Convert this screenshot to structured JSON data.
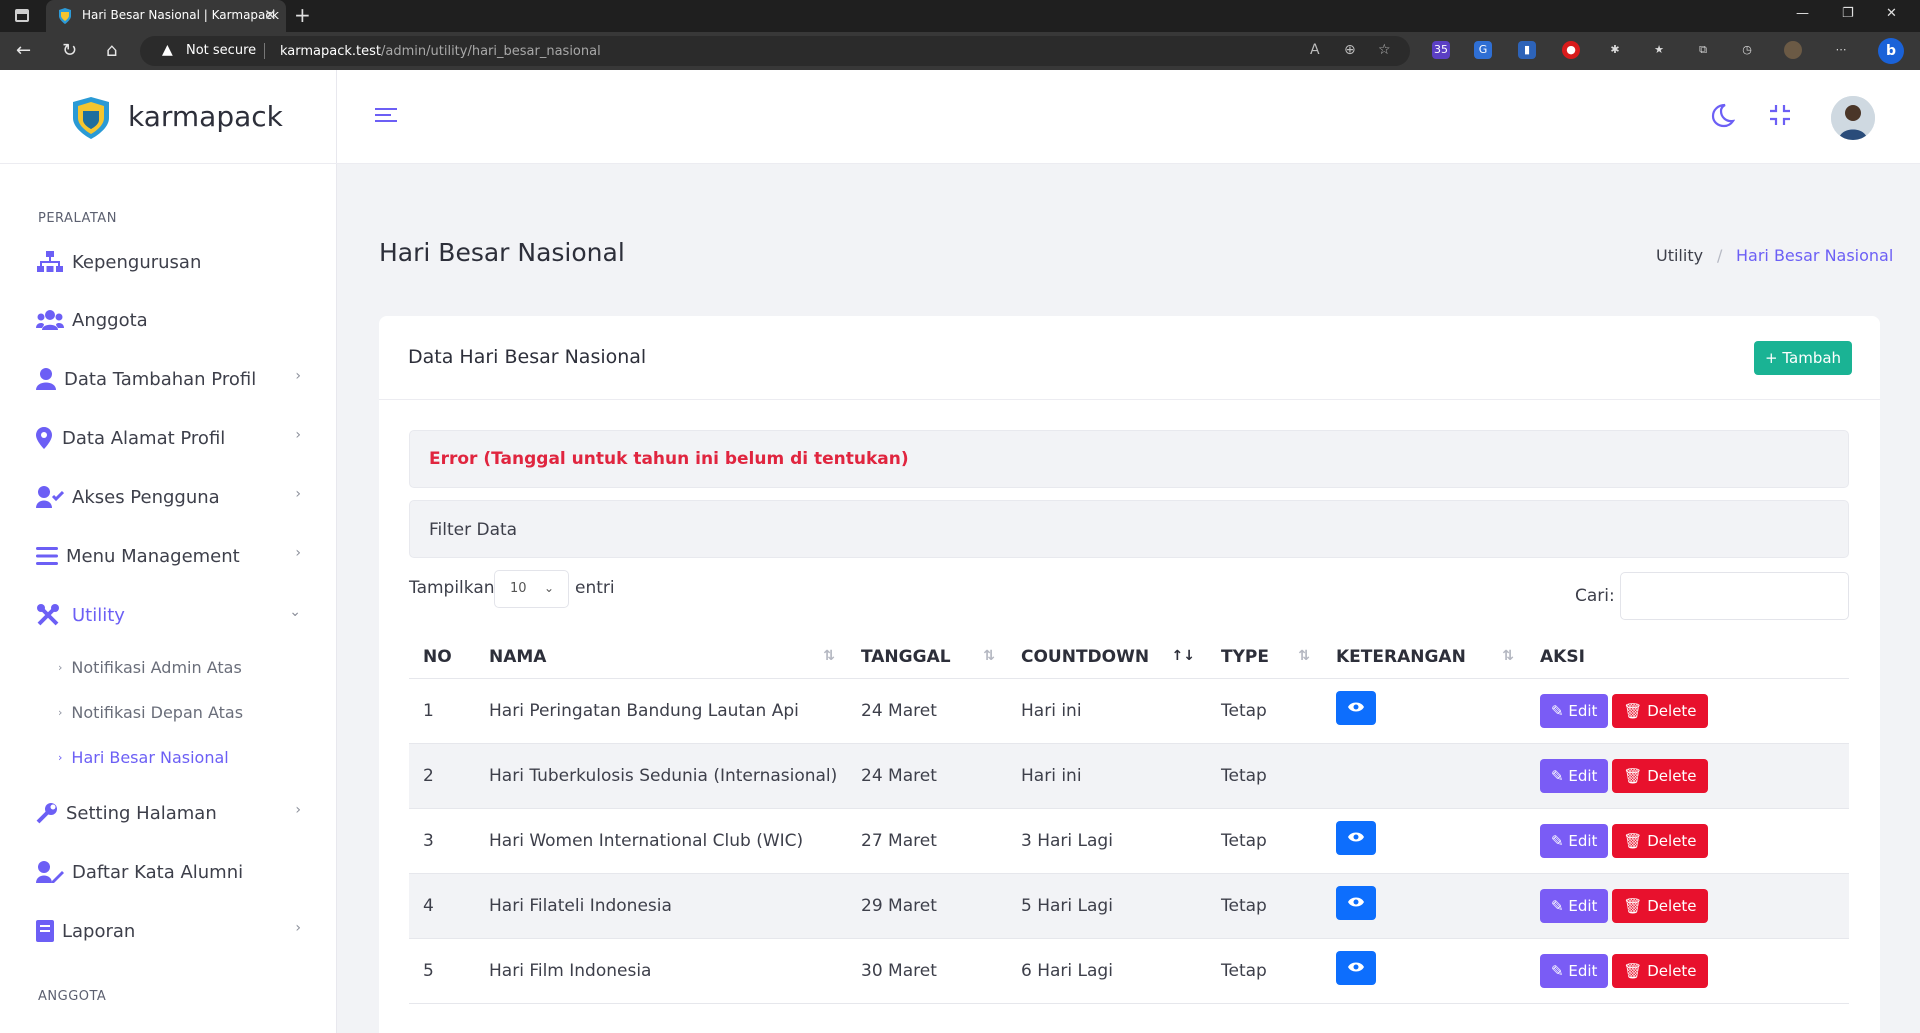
{
  "browser": {
    "tab_title": "Hari Besar Nasional | Karmapack",
    "security_label": "Not secure",
    "url_host": "karmapack.test",
    "url_path": "/admin/utility/hari_besar_nasional",
    "extension_badge": "35"
  },
  "sidebar": {
    "logo_text": "karmapack",
    "section_peralatan": "PERALATAN",
    "section_anggota": "ANGGOTA",
    "items": [
      {
        "label": "Kepengurusan",
        "icon": "sitemap-icon"
      },
      {
        "label": "Anggota",
        "icon": "users-icon"
      },
      {
        "label": "Data Tambahan Profil",
        "icon": "user-icon"
      },
      {
        "label": "Data Alamat Profil",
        "icon": "map-pin-icon"
      },
      {
        "label": "Akses Pengguna",
        "icon": "user-check-icon"
      },
      {
        "label": "Menu Management",
        "icon": "bars-icon"
      },
      {
        "label": "Utility",
        "icon": "tools-icon"
      },
      {
        "label": "Setting Halaman",
        "icon": "wrench-icon"
      },
      {
        "label": "Daftar Kata Alumni",
        "icon": "user-edit-icon"
      },
      {
        "label": "Laporan",
        "icon": "book-icon"
      }
    ],
    "utility_sub": [
      {
        "label": "Notifikasi Admin Atas"
      },
      {
        "label": "Notifikasi Depan Atas"
      },
      {
        "label": "Hari Besar Nasional"
      }
    ]
  },
  "page": {
    "title": "Hari Besar Nasional",
    "breadcrumb": [
      "Utility",
      "Hari Besar Nasional"
    ],
    "breadcrumb_sep": "/"
  },
  "card": {
    "title": "Data Hari Besar Nasional",
    "add_button": "Tambah",
    "error_text": "Error (Tanggal untuk tahun ini belum di tentukan)",
    "filter_text": "Filter Data",
    "show_label": "Tampilkan",
    "show_value": "10",
    "entries_label": "entri",
    "search_label": "Cari:"
  },
  "table": {
    "headers": [
      "NO",
      "NAMA",
      "TANGGAL",
      "COUNTDOWN",
      "TYPE",
      "KETERANGAN",
      "AKSI"
    ],
    "rows": [
      {
        "no": "1",
        "nama": "Hari Peringatan Bandung Lautan Api",
        "tanggal": "24 Maret",
        "countdown": "Hari ini",
        "type": "Tetap",
        "has_info": true
      },
      {
        "no": "2",
        "nama": "Hari Tuberkulosis Sedunia (Internasional)",
        "tanggal": "24 Maret",
        "countdown": "Hari ini",
        "type": "Tetap",
        "has_info": false
      },
      {
        "no": "3",
        "nama": "Hari Women International Club (WIC)",
        "tanggal": "27 Maret",
        "countdown": "3 Hari Lagi",
        "type": "Tetap",
        "has_info": true
      },
      {
        "no": "4",
        "nama": "Hari Filateli Indonesia",
        "tanggal": "29 Maret",
        "countdown": "5 Hari Lagi",
        "type": "Tetap",
        "has_info": true
      },
      {
        "no": "5",
        "nama": "Hari Film Indonesia",
        "tanggal": "30 Maret",
        "countdown": "6 Hari Lagi",
        "type": "Tetap",
        "has_info": true
      }
    ],
    "edit_label": "Edit",
    "delete_label": "Delete"
  },
  "colors": {
    "accent": "#6c5ff5",
    "success": "#1ab394",
    "danger": "#e8112d",
    "error_text": "#e0253f",
    "info": "#0d6efd"
  }
}
